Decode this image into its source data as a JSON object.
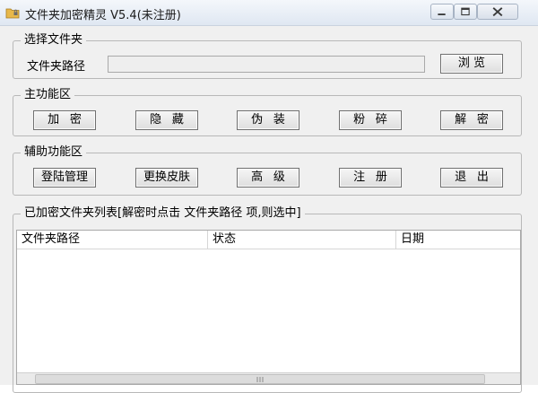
{
  "window": {
    "title": "文件夹加密精灵 V5.4(未注册)"
  },
  "select_folder": {
    "group_label": "选择文件夹",
    "path_label": "文件夹路径",
    "path_value": "",
    "browse_label": "浏  览"
  },
  "main_functions": {
    "group_label": "主功能区",
    "buttons": [
      "加密",
      "隐藏",
      "伪装",
      "粉碎",
      "解密"
    ]
  },
  "aux_functions": {
    "group_label": "辅助功能区",
    "buttons": [
      "登陆管理",
      "更换皮肤",
      "高级",
      "注册",
      "退出"
    ]
  },
  "encrypted_list": {
    "group_label": "已加密文件夹列表[解密时点击 文件夹路径 项,则选中]",
    "columns": [
      "文件夹路径",
      "状态",
      "日期"
    ],
    "rows": []
  },
  "icons": {
    "app": "folder-lock-icon",
    "minimize": "minimize-icon",
    "maximize": "maximize-icon",
    "close": "close-icon"
  }
}
